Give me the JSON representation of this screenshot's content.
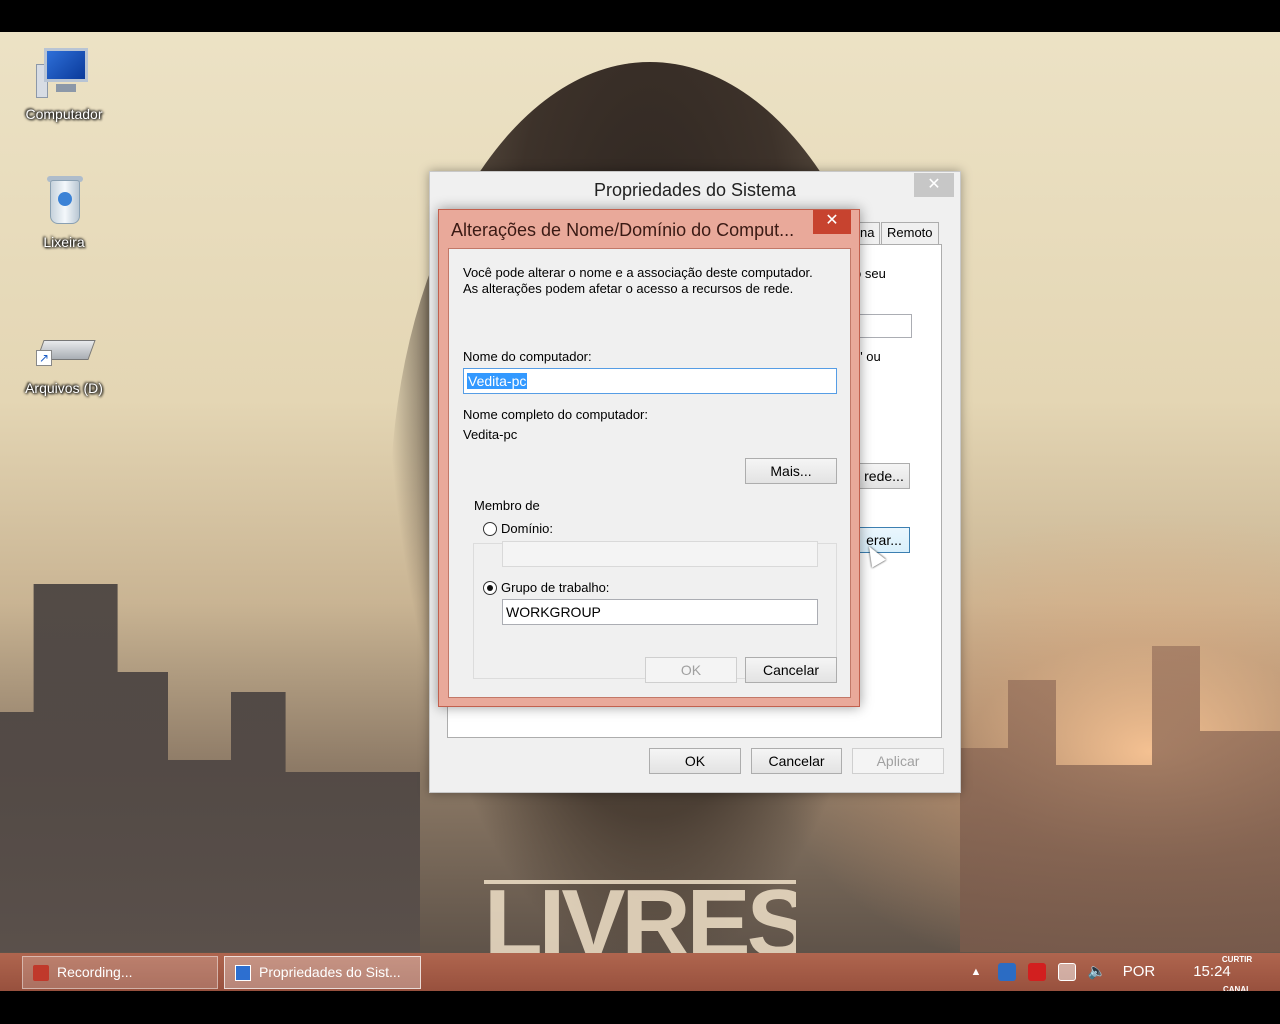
{
  "desktop": {
    "icons": [
      {
        "label": "Computador"
      },
      {
        "label": "Lixeira"
      },
      {
        "label": "Arquivos (D)"
      }
    ],
    "wallpaper_text": "LIVRES"
  },
  "system_properties": {
    "title": "Propriedades do Sistema",
    "close_glyph": "✕",
    "tabs": [
      "na",
      "Remoto"
    ],
    "fragments": {
      "seu": "o seu",
      "ou": "\" ou",
      "rede_button": "rede...",
      "alterar_button": "erar..."
    },
    "buttons": {
      "ok": "OK",
      "cancel": "Cancelar",
      "apply": "Aplicar"
    }
  },
  "change_dialog": {
    "title": "Alterações de Nome/Domínio do Comput...",
    "close_glyph": "✕",
    "description_line1": "Você pode alterar o nome e a associação deste computador.",
    "description_line2": "As alterações podem afetar o acesso a recursos de rede.",
    "computer_name_label": "Nome do computador:",
    "computer_name_value": "Vedita-pc",
    "full_name_label": "Nome completo do computador:",
    "full_name_value": "Vedita-pc",
    "more_button": "Mais...",
    "member_of_label": "Membro de",
    "domain_label": "Domínio:",
    "domain_value": "",
    "domain_selected": false,
    "workgroup_label": "Grupo de trabalho:",
    "workgroup_value": "WORKGROUP",
    "workgroup_selected": true,
    "ok_button": "OK",
    "cancel_button": "Cancelar"
  },
  "taskbar": {
    "items": [
      {
        "label": "Recording...",
        "active": false
      },
      {
        "label": "Propriedades do Sist...",
        "active": true
      }
    ],
    "tray": {
      "language": "POR",
      "clock": "15:24",
      "overlay_top": "CURTIR",
      "overlay_bottom": "CANAL"
    }
  },
  "colors": {
    "dialog_accent": "#e9a99a",
    "dialog_close": "#c7432f",
    "taskbar": "#b66a52",
    "selection": "#3399ff"
  }
}
